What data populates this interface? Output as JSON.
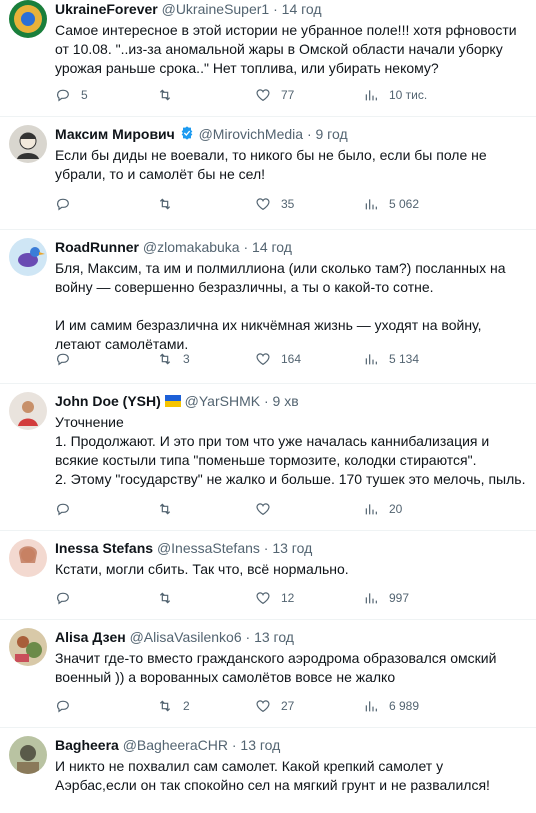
{
  "tweets": [
    {
      "name": "UkraineForever",
      "handle": "@UkraineSuper1",
      "sep": "·",
      "time": "14 год",
      "text": "Самое интересное в этой истории не убранное поле!!! хотя рфновости от 10.08. \"..из-за аномальной жары в Омской области начали уборку урожая раньше срока..\" Нет топлива, или убирать некому?",
      "replies": "5",
      "retweets": "",
      "likes": "77",
      "views": "10 тис."
    },
    {
      "name": "Максим Мирович",
      "handle": "@MirovichMedia",
      "sep": "·",
      "time": "9 год",
      "text": "Если бы диды не воевали, то никого бы не было, если бы поле не убрали, то и самолёт бы не сел!",
      "replies": "",
      "retweets": "",
      "likes": "35",
      "views": "5 062"
    },
    {
      "name": "RoadRunner",
      "handle": "@zlomakabuka",
      "sep": "·",
      "time": "14 год",
      "text": "Бля, Максим, та им и полмиллиона (или сколько там?) посланных на войну — совершенно безразличны, а ты о какой-то сотне.\n\nИ им самим безразлична их никчёмная жизнь — уходят на войну, летают самолётами.",
      "replies": "",
      "retweets": "3",
      "likes": "164",
      "views": "5 134"
    },
    {
      "name": "John Doe (YSH)",
      "handle": "@YarSHMK",
      "sep": "·",
      "time": "9 хв",
      "text": "Уточнение\n1. Продолжают. И это при том что уже началась каннибализация и всякие костыли типа \"поменьше тормозите, колодки стираются\".\n2. Этому \"государству\" не жалко и больше. 170 тушек это мелочь, пыль.",
      "replies": "",
      "retweets": "",
      "likes": "",
      "views": "20"
    },
    {
      "name": "Inessa Stefans",
      "handle": "@InessaStefans",
      "sep": "·",
      "time": "13 год",
      "text": "Кстати, могли сбить. Так что, всё нормально.",
      "replies": "",
      "retweets": "",
      "likes": "12",
      "views": "997"
    },
    {
      "name": "Alisa Дзен",
      "handle": "@AlisaVasilenko6",
      "sep": "·",
      "time": "13 год",
      "text": "Значит где-то вместо гражданского аэродрома образовался омский военный )) а ворованных самолётов вовсе не жалко",
      "replies": "",
      "retweets": "2",
      "likes": "27",
      "views": "6 989"
    },
    {
      "name": "Bagheera",
      "handle": "@BagheeraCHR",
      "sep": "·",
      "time": "13 год",
      "text": "И никто не похвалил сам самолет. Какой крепкий самолет у Аэрбас,если он так спокойно сел на мягкий грунт и не развалился!",
      "replies": "",
      "retweets": "",
      "likes": "",
      "views": ""
    }
  ],
  "colors": {
    "verified": "#1d9bf0",
    "text": "#0f1419",
    "meta": "#536471",
    "divider": "#eff3f4"
  },
  "icons": [
    "reply-icon",
    "retweet-icon",
    "like-icon",
    "views-icon",
    "verified-badge-icon",
    "ukraine-flag-icon"
  ]
}
